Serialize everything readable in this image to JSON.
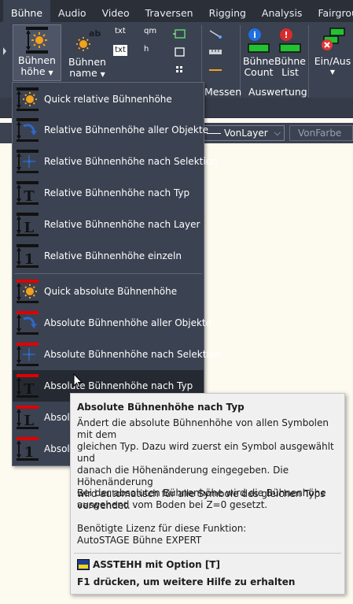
{
  "tabs": [
    {
      "label": "Bühne",
      "active": true
    },
    {
      "label": "Audio",
      "active": false
    },
    {
      "label": "Video",
      "active": false
    },
    {
      "label": "Traversen",
      "active": false
    },
    {
      "label": "Rigging",
      "active": false
    },
    {
      "label": "Analysis",
      "active": false
    },
    {
      "label": "Fairground",
      "active": false
    }
  ],
  "ribbon": {
    "buehnenhoehe": {
      "line1": "Bühnen",
      "line2": "höhe"
    },
    "buehnenname": {
      "line1": "Bühnen",
      "line2": "name"
    },
    "buehne_count": {
      "line1": "Bühne",
      "line2": "Count"
    },
    "buehne_list": {
      "line1": "Bühne",
      "line2": "List"
    },
    "ein_aus": {
      "line1": "Ein/Aus"
    },
    "small_labels": {
      "txt1": "txt",
      "qm": "qm",
      "txt2": "txt",
      "h": "h",
      "ab": "ab"
    },
    "groups": {
      "messen": "Messen",
      "auswertung": "Auswertung"
    }
  },
  "propbar": {
    "linetype": "VonLayer",
    "color": "VonFarbe"
  },
  "menu": {
    "items": [
      {
        "label": "Quick relative Bühnenhöhe"
      },
      {
        "label": "Relative Bühnenhöhe aller Objekte"
      },
      {
        "label": "Relative Bühnenhöhe nach Selektion"
      },
      {
        "label": "Relative Bühnenhöhe nach Typ"
      },
      {
        "label": "Relative Bühnenhöhe nach Layer"
      },
      {
        "label": "Relative Bühnenhöhe einzeln"
      },
      {
        "label": "Quick absolute Bühnenhöhe"
      },
      {
        "label": "Absolute Bühnenhöhe aller Objekte"
      },
      {
        "label": "Absolute Bühnenhöhe nach Selektion"
      },
      {
        "label": "Absolute Bühnenhöhe nach Typ"
      },
      {
        "label": "Absolu"
      },
      {
        "label": "Absolu"
      }
    ],
    "icon_letters": {
      "typ": "T",
      "layer": "L",
      "einzeln": "1"
    }
  },
  "tooltip": {
    "title": "Absolute Bühnenhöhe nach Typ",
    "p1": [
      "Ändert die absolute Bühnenhöhe von allen Symbolen mit dem",
      "gleichen Typ. Dazu wird zuerst ein Symbol ausgewählt und",
      "danach die Höhenänderung eingegeben. Die Höhenänderung",
      "wird automatisch für alle Symbole des gleichen Typs",
      "verwendet."
    ],
    "p2": [
      "Bei der absoluten Bühnenhöhe wird die Bühnenhöhe",
      "ausgehend vom Boden bei Z=0 gesetzt."
    ],
    "p3": [
      "Benötigte Lizenz für diese Funktion:",
      "AutoSTAGE Bühne EXPERT"
    ],
    "command": "ASSTEHH mit Option [T]",
    "help": "F1 drücken, um weitere Hilfe zu erhalten"
  },
  "colors": {
    "relative_bar": "#111111",
    "absolute_bar": "#e00000",
    "sun": "#f4a21b",
    "accent": "#3b4251"
  }
}
